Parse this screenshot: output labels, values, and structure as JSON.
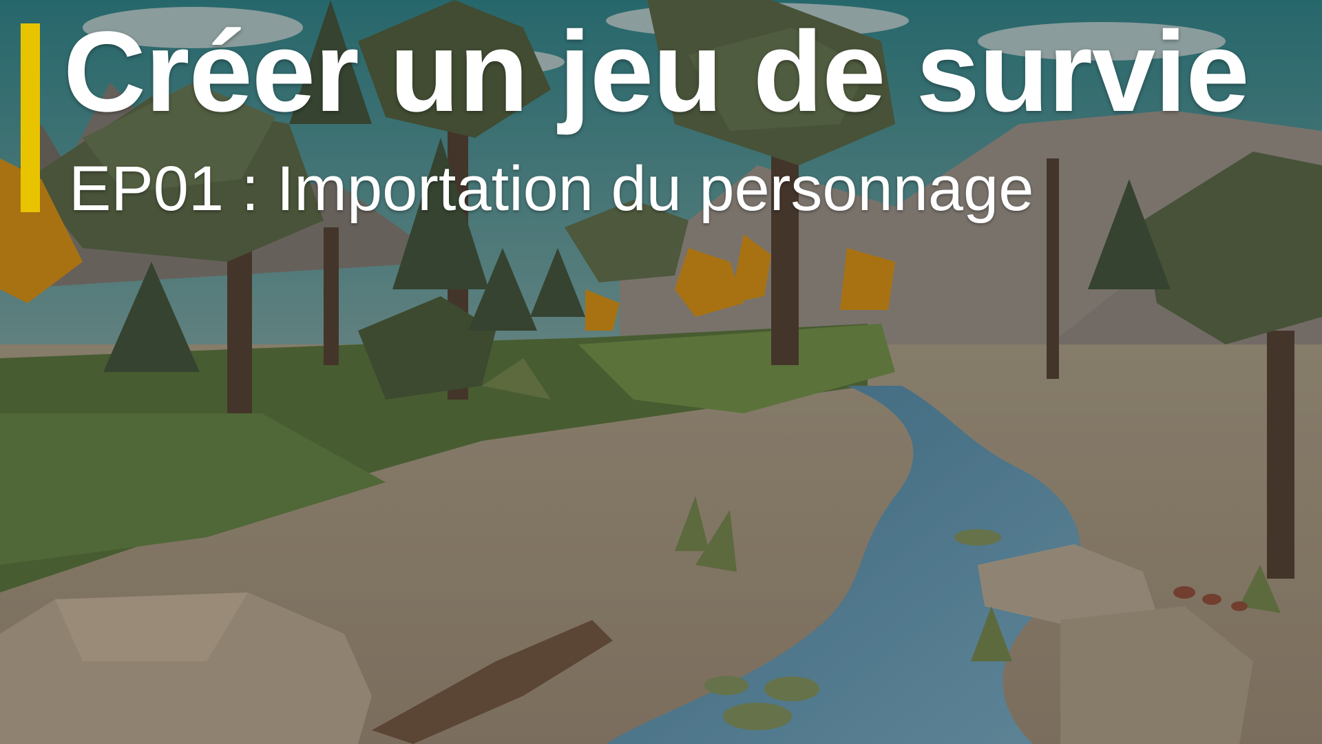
{
  "thumbnail": {
    "title": "Créer un jeu de survie",
    "subtitle": "EP01 : Importation du personnage"
  },
  "colors": {
    "accent": "#E8C400",
    "sky": "#3C8A8C",
    "foliage": "#5E6E48",
    "autumn": "#E89A10",
    "water": "#6FA4C2",
    "sand": "#B9A98E",
    "title_text": "#FFFFFF"
  },
  "scene": {
    "description_icon": "low-poly-forest-river"
  }
}
